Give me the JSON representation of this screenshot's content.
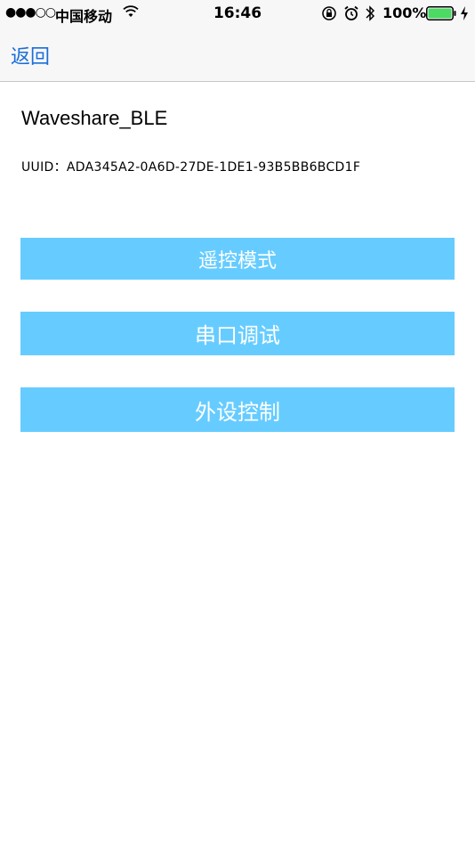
{
  "status_bar": {
    "signal": "●●●○○",
    "carrier": "中国移动",
    "time": "16:46",
    "battery_percent": "100%",
    "icons": [
      "wifi-icon",
      "orientation-lock-icon",
      "alarm-icon",
      "bluetooth-icon",
      "battery-icon",
      "charging-icon"
    ]
  },
  "nav": {
    "back_label": "返回"
  },
  "device": {
    "name": "Waveshare_BLE",
    "uuid": "UUID：ADA345A2-0A6D-27DE-1DE1-93B5BB6BCD1F"
  },
  "buttons": {
    "remote_control": "遥控模式",
    "serial_debug": "串口调试",
    "peripheral_control": "外设控制"
  },
  "colors": {
    "button_bg": "#66ccff",
    "button_text": "#ffffff",
    "link": "#1a6ed8",
    "battery": "#4cd964"
  }
}
